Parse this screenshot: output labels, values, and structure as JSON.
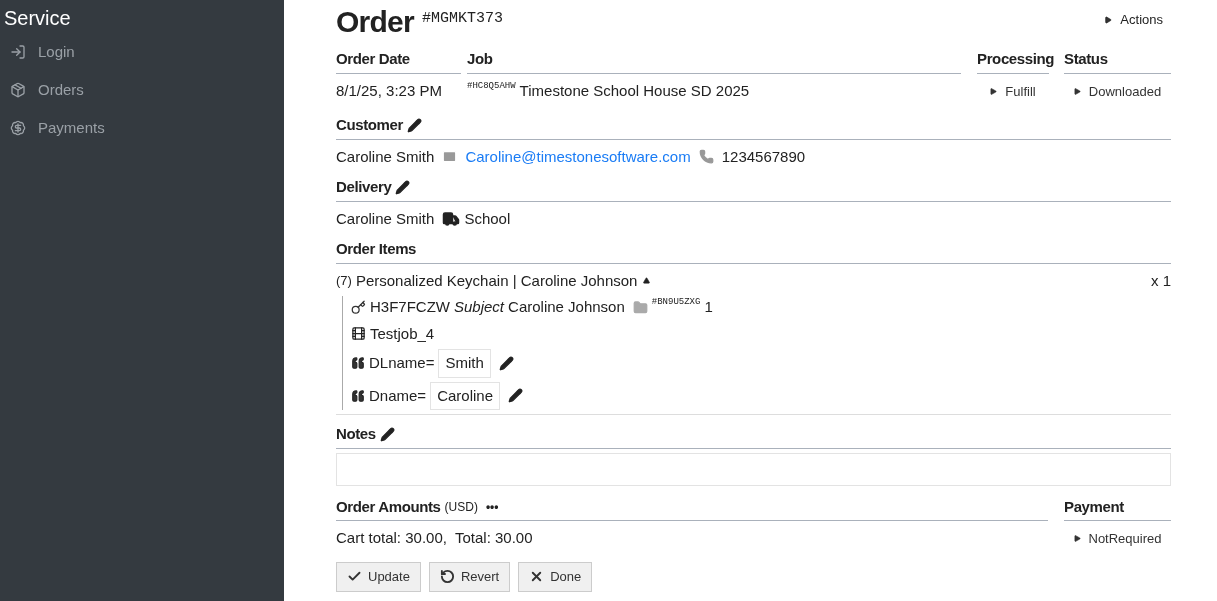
{
  "sidebar": {
    "title": "Service",
    "items": [
      {
        "label": "Login"
      },
      {
        "label": "Orders"
      },
      {
        "label": "Payments"
      }
    ]
  },
  "order": {
    "title": "Order",
    "number": "#MGMKT373",
    "actions": "Actions"
  },
  "header": {
    "date_label": "Order Date",
    "date": "8/1/25, 3:23 PM",
    "job_label": "Job",
    "job_code": "#HC8Q5AHW",
    "job": "Timestone School House SD 2025",
    "processing_label": "Processing",
    "processing": "Fulfill",
    "status_label": "Status",
    "status": "Downloaded"
  },
  "customer": {
    "label": "Customer",
    "name": "Caroline Smith",
    "email": "Caroline@timestonesoftware.com",
    "phone": "1234567890"
  },
  "delivery": {
    "label": "Delivery",
    "name": "Caroline Smith",
    "method": "School"
  },
  "order_items": {
    "label": "Order Items",
    "items": [
      {
        "count": "(7)",
        "title": "Personalized Keychain | Caroline Johnson",
        "quantity": "x 1",
        "expanded": true,
        "code": "H3F7FCZW",
        "subject_label": "Subject",
        "subject": "Caroline Johnson",
        "folder": "#BN9U5ZXG",
        "folder_count": "1",
        "job": "Testjob_4",
        "fields": [
          {
            "name": "DLname=",
            "value": "Smith"
          },
          {
            "name": "Dname=",
            "value": "Caroline"
          }
        ]
      }
    ]
  },
  "notes": {
    "label": "Notes"
  },
  "amounts": {
    "label": "Order Amounts",
    "currency": "(USD)",
    "more": "•••",
    "totals": "Cart total: 30.00,  Total: 30.00"
  },
  "payment": {
    "label": "Payment",
    "value": "NotRequired"
  },
  "buttons": [
    {
      "label": "Update"
    },
    {
      "label": "Revert"
    },
    {
      "label": "Done"
    }
  ]
}
